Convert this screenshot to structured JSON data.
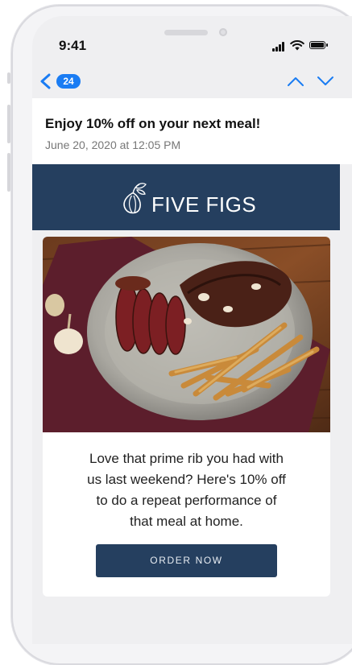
{
  "status_bar": {
    "time": "9:41"
  },
  "nav": {
    "unread_count": "24",
    "back_icon": "chevron-left-icon",
    "up_icon": "chevron-up-icon",
    "down_icon": "chevron-down-icon"
  },
  "email": {
    "subject": "Enjoy 10% off on your next meal!",
    "date": "June 20, 2020 at 12:05 PM"
  },
  "brand": {
    "name": "FIVE FIGS",
    "logo_icon": "fig-icon",
    "color": "#253f5f"
  },
  "content": {
    "body_lines": [
      "Love that prime rib you had with",
      "us last weekend? Here's 10% off",
      "to do a repeat performance of",
      "that meal at home."
    ],
    "cta_label": "ORDER NOW"
  },
  "colors": {
    "accent": "#1a7cf3",
    "brand": "#253f5f"
  }
}
